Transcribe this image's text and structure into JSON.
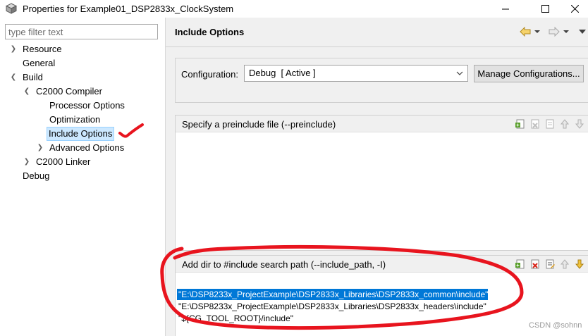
{
  "window": {
    "title": "Properties for Example01_DSP2833x_ClockSystem",
    "minimize": "—",
    "maximize": "☐",
    "close": "✕"
  },
  "filter": {
    "placeholder": "type filter text",
    "value": ""
  },
  "tree": {
    "resource": "Resource",
    "general": "General",
    "build": "Build",
    "c2000_compiler": "C2000 Compiler",
    "processor_options": "Processor Options",
    "optimization": "Optimization",
    "include_options": "Include Options",
    "advanced_options": "Advanced Options",
    "c2000_linker": "C2000 Linker",
    "debug": "Debug"
  },
  "page": {
    "title": "Include Options"
  },
  "configuration": {
    "label": "Configuration:",
    "selected": "Debug  [ Active ]",
    "manage_button": "Manage Configurations..."
  },
  "preinclude": {
    "header": "Specify a preinclude file (--preinclude)",
    "items": []
  },
  "include_path": {
    "header": "Add dir to #include search path (--include_path, -I)",
    "items": [
      "\"E:\\DSP8233x_ProjectExample\\DSP2833x_Libraries\\DSP2833x_common\\include\"",
      "\"E:\\DSP8233x_ProjectExample\\DSP2833x_Libraries\\DSP2833x_headers\\include\"",
      "\"${CG_TOOL_ROOT}/include\""
    ]
  },
  "watermark": "CSDN @sohnn",
  "colors": {
    "selection": "#0078d7",
    "tree_selection": "#cce8ff",
    "annotation": "#e8141e",
    "panel_bg": "#f0f0f0"
  }
}
